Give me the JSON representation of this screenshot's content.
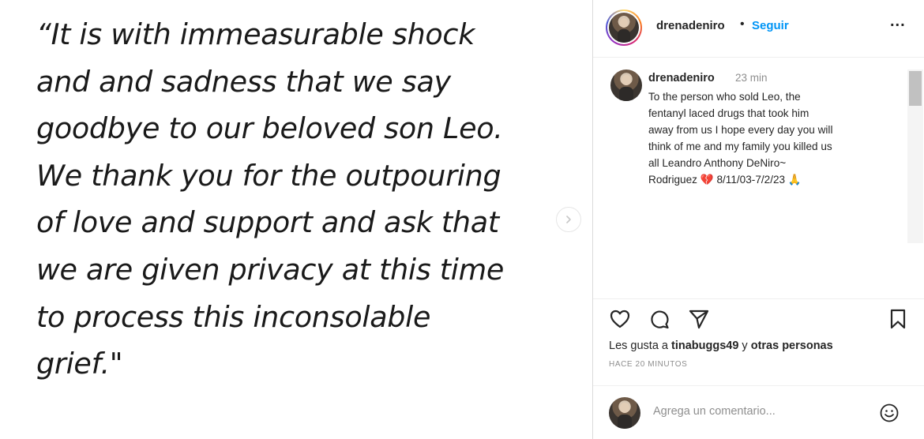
{
  "post": {
    "quote_lines": [
      "“It is with immeasurable shock",
      "and and sadness that we say",
      "goodbye to our beloved son Leo.",
      "We thank you for the outpouring",
      "of love and support and ask that",
      "we are given privacy at this time",
      "to process this inconsolable",
      "grief.\""
    ],
    "next_icon": "chevron-right-icon"
  },
  "header": {
    "username": "drenadeniro",
    "separator": "•",
    "follow_label": "Seguir",
    "more_label": "...",
    "avatar_icon": "profile-avatar"
  },
  "caption": {
    "username": "drenadeniro",
    "time": "23 min",
    "text_lines": [
      "To the person who sold Leo, the",
      "fentanyl laced drugs that took him",
      "away from us I hope every day you will",
      "think of me and my family you killed us",
      "all Leandro Anthony DeNiro~",
      "Rodriguez 💔 8/11/03-7/2/23 🙏"
    ]
  },
  "actions": {
    "icons": [
      "heart-icon",
      "comment-icon",
      "share-icon",
      "bookmark-icon"
    ]
  },
  "likes": {
    "prefix": "Les gusta a ",
    "user": "tinabuggs49",
    "middle": " y ",
    "others": "otras personas"
  },
  "timestamp": "HACE 20 MINUTOS",
  "add_comment": {
    "placeholder": "Agrega un comentario...",
    "emoji_icon": "emoji-icon"
  },
  "colors": {
    "link": "#0095f6",
    "text": "#262626",
    "muted": "#8e8e8e",
    "border": "#dbdbdb"
  }
}
